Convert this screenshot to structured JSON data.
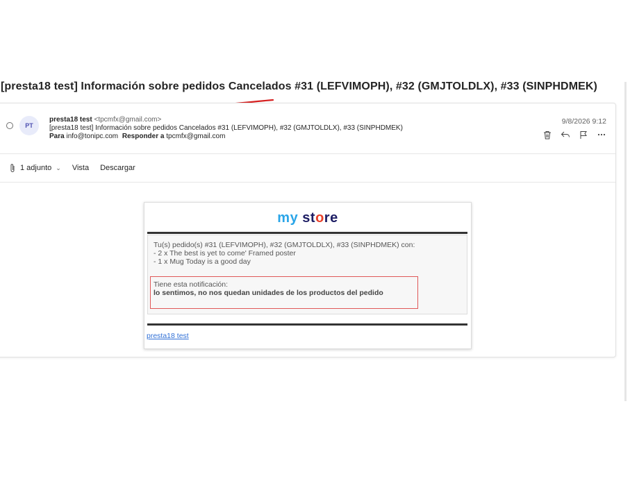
{
  "subject": "[presta18 test] Información sobre pedidos Cancelados #31 (LEFVIMOPH), #32 (GMJTOLDLX), #33 (SINPHDMEK)",
  "message": {
    "avatar_initials": "PT",
    "sender_name": "presta18 test",
    "sender_email": "<tpcmfx@gmail.com>",
    "subject_line": "[presta18 test] Información sobre pedidos Cancelados #31 (LEFVIMOPH), #32 (GMJTOLDLX), #33 (SINPHDMEK)",
    "to_label": "Para",
    "to_value": "info@tonipc.com",
    "reply_to_label": "Responder a",
    "reply_to_value": "tpcmfx@gmail.com",
    "date": "9/8/2026 9:12"
  },
  "actions": [
    "trash-icon",
    "reply-icon",
    "flag-icon",
    "more-icon"
  ],
  "attachments": {
    "count_label": "1 adjunto",
    "view_label": "Vista",
    "download_label": "Descargar"
  },
  "email_body": {
    "logo_my": "my",
    "logo_st": "st",
    "logo_o": "o",
    "logo_re": "re",
    "order_intro": "Tu(s) pedido(s) #31 (LEFVIMOPH), #32 (GMJTOLDLX), #33 (SINPHDMEK) con:",
    "order_items": [
      "- 2 x The best is yet to come' Framed poster",
      "- 1 x Mug Today is a good day"
    ],
    "notification_label": "Tiene esta notificación:",
    "notification_message": "lo sentimos, no nos quedan unidades de los productos del pedido",
    "footer_link": "presta18 test"
  },
  "colors": {
    "logo_my": "#2aa5e8",
    "logo_store": "#1d1d64",
    "logo_accent": "#e8412a",
    "annotation_red": "#d62020",
    "link_blue": "#2f6fd6"
  }
}
